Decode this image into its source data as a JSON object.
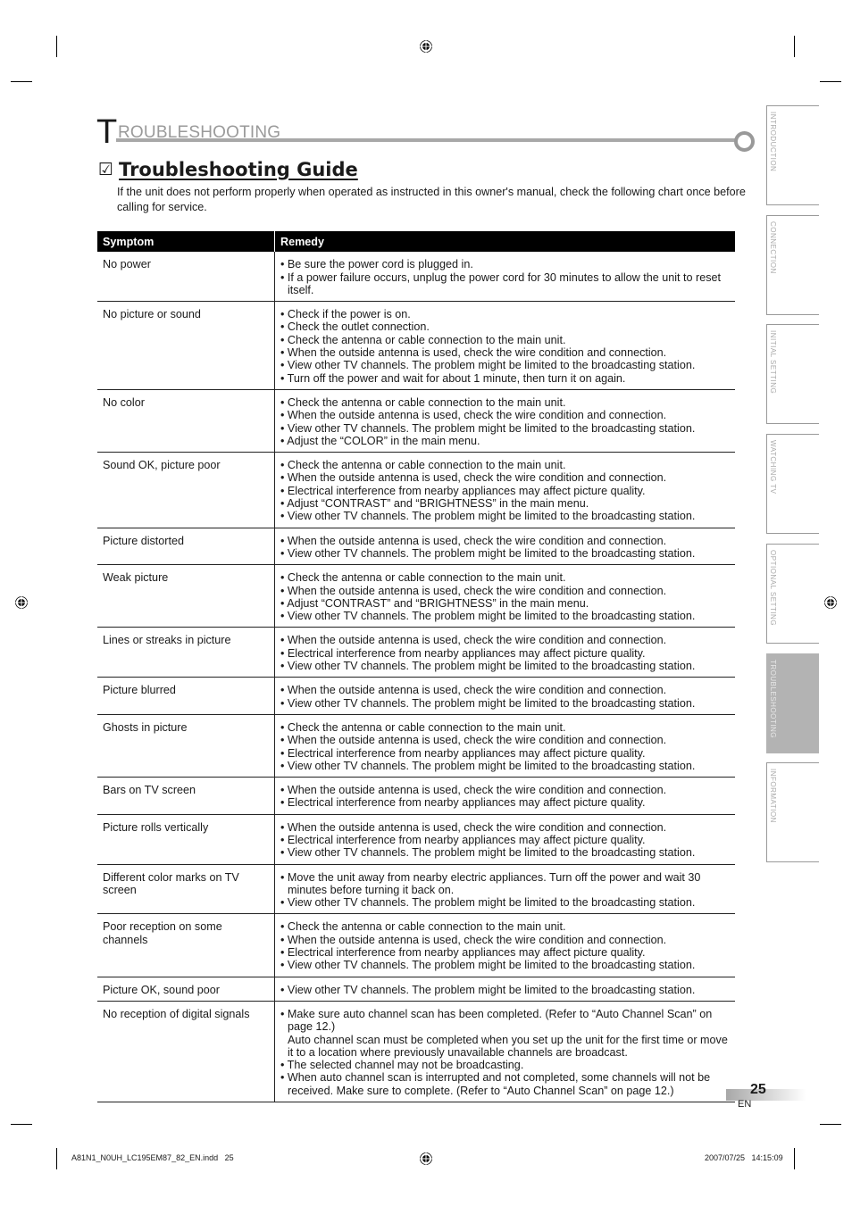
{
  "header": {
    "initial": "T",
    "rest": "ROUBLESHOOTING"
  },
  "section": {
    "check_icon": "☑",
    "title": "Troubleshooting Guide",
    "intro": "If the unit does not perform properly when operated as instructed in this owner's manual, check the following chart once before calling for service."
  },
  "table": {
    "headers": {
      "symptom": "Symptom",
      "remedy": "Remedy"
    },
    "rows": [
      {
        "symptom": "No power",
        "remedies": [
          "• Be sure the power cord is plugged in.",
          "• If a power failure occurs, unplug the power cord for 30 minutes to allow the unit to reset itself."
        ]
      },
      {
        "symptom": "No picture or sound",
        "remedies": [
          "• Check if the power is on.",
          "• Check the outlet connection.",
          "• Check the antenna or cable connection to the main unit.",
          "• When the outside antenna is used, check the wire condition and connection.",
          "• View other TV channels. The problem might be limited to the broadcasting station.",
          "• Turn off the power and wait for about 1 minute, then turn it on again."
        ]
      },
      {
        "symptom": "No color",
        "remedies": [
          "• Check the antenna or cable connection to the main unit.",
          "• When the outside antenna is used, check the wire condition and connection.",
          "• View other TV channels. The problem might be limited to the broadcasting station.",
          "• Adjust the “COLOR” in the main menu."
        ]
      },
      {
        "symptom": "Sound OK, picture poor",
        "remedies": [
          "• Check the antenna or cable connection to the main unit.",
          "• When the outside antenna is used, check the wire condition and connection.",
          "• Electrical interference from nearby appliances may affect picture quality.",
          "• Adjust “CONTRAST” and “BRIGHTNESS” in the main menu.",
          "• View other TV channels. The problem might be limited to the broadcasting station."
        ]
      },
      {
        "symptom": "Picture distorted",
        "remedies": [
          "• When the outside antenna is used, check the wire condition and connection.",
          "• View other TV channels. The problem might be limited to the broadcasting station."
        ]
      },
      {
        "symptom": "Weak picture",
        "remedies": [
          "• Check the antenna or cable connection to the main unit.",
          "• When the outside antenna is used, check the wire condition and connection.",
          "• Adjust “CONTRAST” and “BRIGHTNESS” in the main menu.",
          "• View other TV channels. The problem might be limited to the broadcasting station."
        ]
      },
      {
        "symptom": "Lines or streaks in picture",
        "remedies": [
          "• When the outside antenna is used, check the wire condition and connection.",
          "• Electrical interference from nearby appliances may affect picture quality.",
          "• View other TV channels. The problem might be limited to the broadcasting station."
        ]
      },
      {
        "symptom": "Picture blurred",
        "remedies": [
          "• When the outside antenna is used, check the wire condition and connection.",
          "• View other TV channels. The problem might be limited to the broadcasting station."
        ]
      },
      {
        "symptom": "Ghosts in picture",
        "remedies": [
          "• Check the antenna or cable connection to the main unit.",
          "• When the outside antenna is used, check the wire condition and connection.",
          "• Electrical interference from nearby appliances may affect picture quality.",
          "• View other TV channels. The problem might be limited to the broadcasting station."
        ]
      },
      {
        "symptom": "Bars on TV screen",
        "remedies": [
          "• When the outside antenna is used, check the wire condition and connection.",
          "• Electrical interference from nearby appliances may affect picture quality."
        ]
      },
      {
        "symptom": "Picture rolls vertically",
        "remedies": [
          "• When the outside antenna is used, check the wire condition and connection.",
          "• Electrical interference from nearby appliances may affect picture quality.",
          "• View other TV channels. The problem might be limited to the broadcasting station."
        ]
      },
      {
        "symptom": "Different color marks on TV screen",
        "remedies": [
          "• Move the unit away from nearby electric appliances. Turn off the power and wait 30 minutes before turning it back on.",
          "• View other TV channels. The problem might be limited to the broadcasting station."
        ]
      },
      {
        "symptom": "Poor reception on some channels",
        "remedies": [
          "• Check the antenna or cable connection to the main unit.",
          "• When the outside antenna is used, check the wire condition and connection.",
          "• Electrical interference from nearby appliances may affect picture quality.",
          "• View other TV channels. The problem might be limited to the broadcasting station."
        ]
      },
      {
        "symptom": "Picture OK, sound poor",
        "remedies": [
          "• View other TV channels. The problem might be limited to the broadcasting station."
        ]
      },
      {
        "symptom": "No reception of digital signals",
        "remedies": [
          "• Make sure auto channel scan has been completed. (Refer to “Auto Channel Scan” on page 12.)",
          "Auto channel scan must be completed when you set up the unit for the first time or move it to a location where previously unavailable channels are broadcast.",
          "• The selected channel may not be broadcasting.",
          "• When auto channel scan is interrupted and not completed, some channels will not be received. Make sure to complete. (Refer to “Auto Channel Scan” on page 12.)"
        ]
      }
    ]
  },
  "side_tabs": [
    {
      "label": "INTRODUCTION",
      "active": false
    },
    {
      "label": "CONNECTION",
      "active": false
    },
    {
      "label": "INITIAL SETTING",
      "active": false
    },
    {
      "label": "WATCHING TV",
      "active": false
    },
    {
      "label": "OPTIONAL SETTING",
      "active": false
    },
    {
      "label": "TROUBLESHOOTING",
      "active": true
    },
    {
      "label": "INFORMATION",
      "active": false
    }
  ],
  "page": {
    "number": "25",
    "language": "EN"
  },
  "footer": {
    "file": "A81N1_N0UH_LC195EM87_82_EN.indd   25",
    "timestamp": "2007/07/25   14:15:09"
  },
  "icons": {
    "registration_mark": "registration-mark-icon",
    "checkbox": "checkbox-checked-icon"
  }
}
